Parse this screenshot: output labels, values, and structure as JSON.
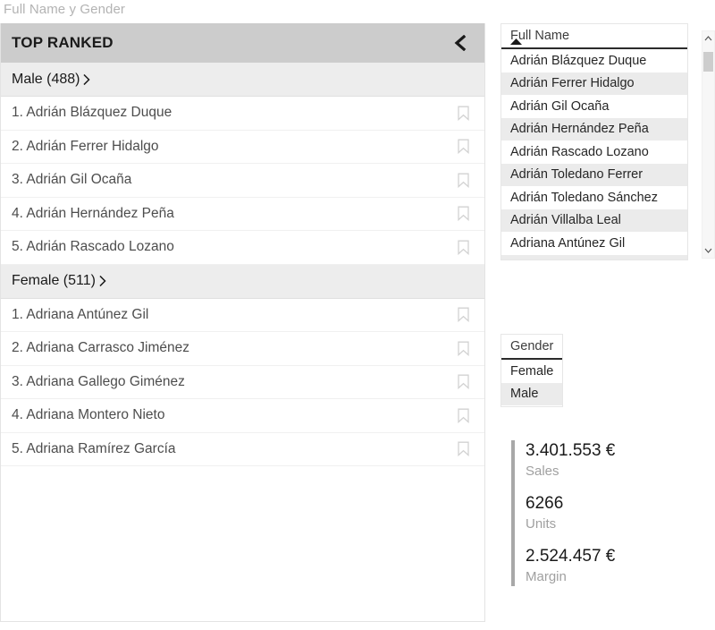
{
  "page": {
    "title": "Full Name y Gender"
  },
  "ranked_panel": {
    "header_title": "TOP RANKED",
    "collapse_icon": "chevron-left-icon",
    "groups": [
      {
        "label": "Male (488)",
        "caret_icon": "chevron-right-icon",
        "items": [
          {
            "label": "1. Adrián Blázquez Duque",
            "bookmark_icon": "bookmark-icon"
          },
          {
            "label": "2. Adrián Ferrer Hidalgo",
            "bookmark_icon": "bookmark-icon"
          },
          {
            "label": "3. Adrián Gil Ocaña",
            "bookmark_icon": "bookmark-icon"
          },
          {
            "label": "4. Adrián Hernández Peña",
            "bookmark_icon": "bookmark-icon"
          },
          {
            "label": "5. Adrián Rascado Lozano",
            "bookmark_icon": "bookmark-icon"
          }
        ]
      },
      {
        "label": "Female (511)",
        "caret_icon": "chevron-right-icon",
        "items": [
          {
            "label": "1. Adriana Antúnez Gil",
            "bookmark_icon": "bookmark-icon"
          },
          {
            "label": "2. Adriana Carrasco Jiménez",
            "bookmark_icon": "bookmark-icon"
          },
          {
            "label": "3. Adriana Gallego Giménez",
            "bookmark_icon": "bookmark-icon"
          },
          {
            "label": "4. Adriana Montero Nieto",
            "bookmark_icon": "bookmark-icon"
          },
          {
            "label": "5. Adriana Ramírez García",
            "bookmark_icon": "bookmark-icon"
          }
        ]
      }
    ]
  },
  "full_name_filter": {
    "title": "Full Name",
    "sort_icon": "sort-ascending-icon",
    "items": [
      {
        "label": "Adrián Blázquez Duque",
        "selected": false
      },
      {
        "label": "Adrián Ferrer Hidalgo",
        "selected": true
      },
      {
        "label": "Adrián Gil Ocaña",
        "selected": false
      },
      {
        "label": "Adrián Hernández Peña",
        "selected": true
      },
      {
        "label": "Adrián Rascado Lozano",
        "selected": false
      },
      {
        "label": "Adrián Toledano Ferrer",
        "selected": true
      },
      {
        "label": "Adrián Toledano Sánchez",
        "selected": false
      },
      {
        "label": "Adrián Villalba Leal",
        "selected": true
      },
      {
        "label": "Adriana Antúnez Gil",
        "selected": false
      }
    ],
    "scrollbar": {
      "up_icon": "chevron-up-icon",
      "down_icon": "chevron-down-icon",
      "thumb_icon": "scroll-thumb"
    }
  },
  "gender_filter": {
    "title": "Gender",
    "items": [
      {
        "label": "Female",
        "selected": false
      },
      {
        "label": "Male",
        "selected": true
      }
    ]
  },
  "kpis": {
    "accent_color": "#a8a8a8",
    "items": [
      {
        "value": "3.401.553 €",
        "label": "Sales"
      },
      {
        "value": "6266",
        "label": "Units"
      },
      {
        "value": "2.524.457 €",
        "label": "Margin"
      }
    ]
  }
}
